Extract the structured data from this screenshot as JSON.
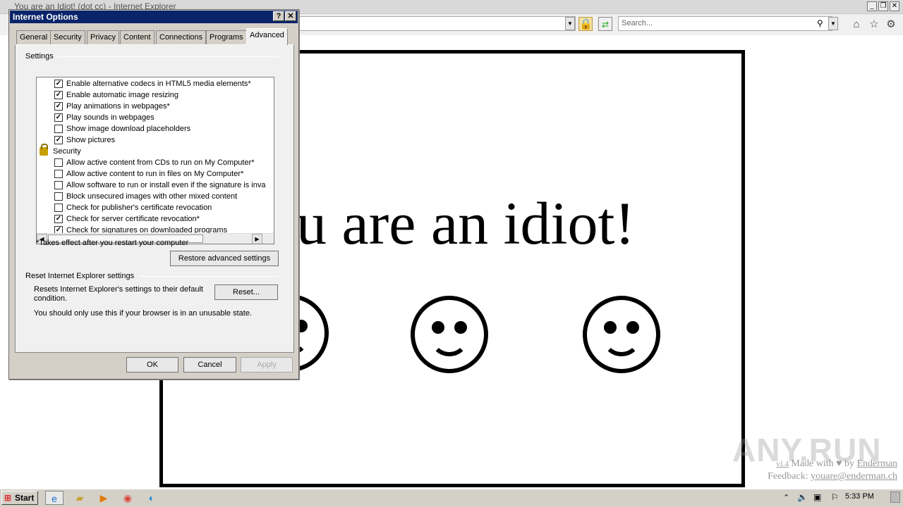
{
  "browser": {
    "title": "You are an Idiot! (dot cc) - Internet Explorer",
    "search_placeholder": "Search..."
  },
  "page": {
    "headline": "ou are an idiot!",
    "credit_line1_version": "v1.4",
    "credit_line1_text": "Made with ♥ by",
    "credit_line1_link": "Enderman",
    "credit_line2_text": "Feedback:",
    "credit_line2_link": "youare@enderman.ch",
    "watermark": "ANY.RUN"
  },
  "dialog": {
    "title": "Internet Options",
    "help": "?",
    "close": "✕",
    "tabs": [
      "General",
      "Security",
      "Privacy",
      "Content",
      "Connections",
      "Programs",
      "Advanced"
    ],
    "active_tab": "Advanced",
    "settings_label": "Settings",
    "items": [
      {
        "label": "Enable alternative codecs in HTML5 media elements*",
        "checked": true
      },
      {
        "label": "Enable automatic image resizing",
        "checked": true
      },
      {
        "label": "Play animations in webpages*",
        "checked": true
      },
      {
        "label": "Play sounds in webpages",
        "checked": true
      },
      {
        "label": "Show image download placeholders",
        "checked": false
      },
      {
        "label": "Show pictures",
        "checked": true
      },
      {
        "label": "Security",
        "header": true
      },
      {
        "label": "Allow active content from CDs to run on My Computer*",
        "checked": false
      },
      {
        "label": "Allow active content to run in files on My Computer*",
        "checked": false
      },
      {
        "label": "Allow software to run or install even if the signature is inva",
        "checked": false
      },
      {
        "label": "Block unsecured images with other mixed content",
        "checked": false
      },
      {
        "label": "Check for publisher's certificate revocation",
        "checked": false
      },
      {
        "label": "Check for server certificate revocation*",
        "checked": true
      },
      {
        "label": "Check for signatures on downloaded programs",
        "checked": true
      }
    ],
    "restart_note": "*Takes effect after you restart your computer",
    "restore_button": "Restore advanced settings",
    "reset_group_label": "Reset Internet Explorer settings",
    "reset_desc": "Resets Internet Explorer's settings to their default condition.",
    "reset_button": "Reset...",
    "reset_warning": "You should only use this if your browser is in an unusable state.",
    "ok": "OK",
    "cancel": "Cancel",
    "apply": "Apply"
  },
  "taskbar": {
    "start": "Start",
    "clock": "5:33 PM"
  }
}
